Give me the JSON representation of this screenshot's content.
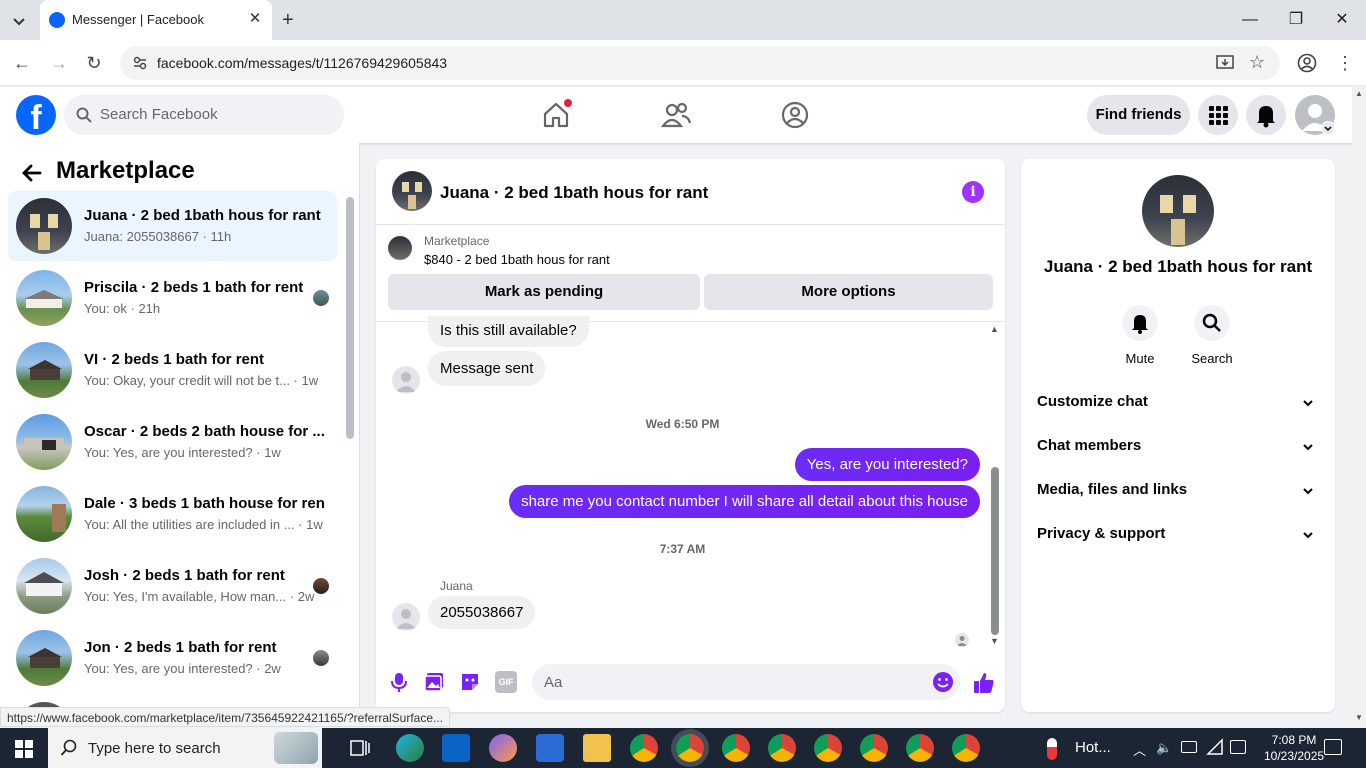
{
  "browser": {
    "tab_title": "Messenger | Facebook",
    "url": "facebook.com/messages/t/1126769429605843",
    "status_url": "https://www.facebook.com/marketplace/item/735645922421165/?referralSurface..."
  },
  "fb": {
    "search_placeholder": "Search Facebook",
    "find_friends": "Find friends"
  },
  "left": {
    "title": "Marketplace",
    "conversations": [
      {
        "name": "Juana · 2 bed 1bath hous for rant",
        "preview": "Juana: 2055038667 · 11h"
      },
      {
        "name": "Priscila · 2 beds 1 bath for rent",
        "preview": "You: ok · 21h"
      },
      {
        "name": "VI · 2 beds 1 bath for rent",
        "preview": "You: Okay, your credit will not be t... · 1w"
      },
      {
        "name": "Oscar · 2 beds 2 bath house for ...",
        "preview": "You: Yes, are you interested? · 1w"
      },
      {
        "name": "Dale · 3 beds 1 bath house for rent",
        "preview": "You: All the utilities are included in ... · 1w"
      },
      {
        "name": "Josh · 2 beds 1 bath for rent",
        "preview": "You: Yes, I'm available, How man... · 2w"
      },
      {
        "name": "Jon · 2 beds 1 bath for rent",
        "preview": "You: Yes, are you interested? · 2w"
      }
    ]
  },
  "chat": {
    "title": "Juana · 2 bed 1bath hous for rant",
    "marketplace_label": "Marketplace",
    "listing": "$840 - 2 bed 1bath hous for rant",
    "mark_pending": "Mark as pending",
    "more_options": "More options",
    "messages": {
      "m1": "Is this still available?",
      "m2": "Message sent",
      "t1": "Wed 6:50 PM",
      "m3": "Yes, are you interested?",
      "m4": "share me you contact number I will share all detail about this house",
      "t2": "7:37 AM",
      "sender": "Juana",
      "m5": "2055038667"
    },
    "composer_placeholder": "Aa",
    "gif": "GIF"
  },
  "right": {
    "name": "Juana · 2 bed 1bath hous for rant",
    "mute": "Mute",
    "search": "Search",
    "sections": [
      "Customize chat",
      "Chat members",
      "Media, files and links",
      "Privacy & support"
    ]
  },
  "taskbar": {
    "search_placeholder": "Type here to search",
    "weather": "Hot...",
    "time": "7:08 PM",
    "date": "10/23/2025"
  },
  "colors": {
    "fb_blue": "#0866ff",
    "outgoing_bubble": "#7a21f5",
    "selected_row": "#ebf5ff"
  }
}
